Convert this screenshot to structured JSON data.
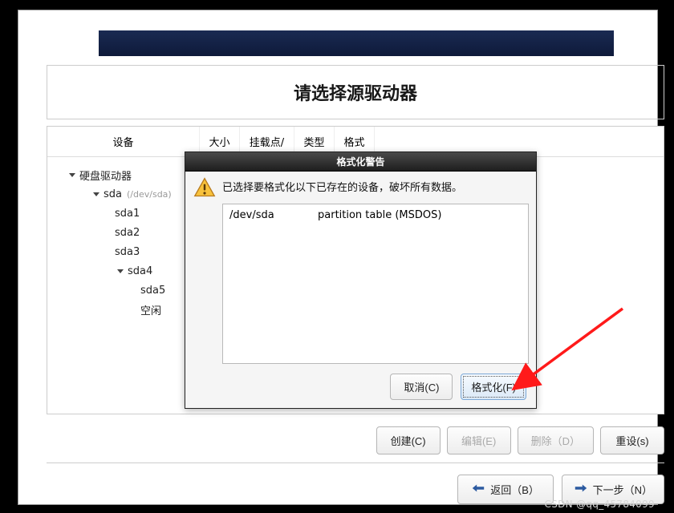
{
  "title_panel": {
    "heading": "请选择源驱动器"
  },
  "table": {
    "columns": {
      "device": "设备",
      "size": "大小",
      "mount": "挂载点/",
      "type_a": "类型",
      "type_b": "格式"
    }
  },
  "tree": {
    "root_label": "硬盘驱动器",
    "sda": {
      "label": "sda",
      "path": "(/dev/sda)"
    },
    "sda1": "sda1",
    "sda2": "sda2",
    "sda3": "sda3",
    "sda4": "sda4",
    "sda5": "sda5",
    "free": "空闲"
  },
  "buttons": {
    "create": "创建(C)",
    "edit": "编辑(E)",
    "delete": "删除（D）",
    "reset": "重设(s)",
    "back": "返回（B）",
    "next": "下一步（N）"
  },
  "dialog": {
    "title": "格式化警告",
    "message": "已选择要格式化以下已存在的设备，破坏所有数据。",
    "device": {
      "path": "/dev/sda",
      "desc": "partition table (MSDOS)"
    },
    "cancel": "取消(C)",
    "format": "格式化(F)"
  },
  "watermark": "CSDN @qq_45784099"
}
